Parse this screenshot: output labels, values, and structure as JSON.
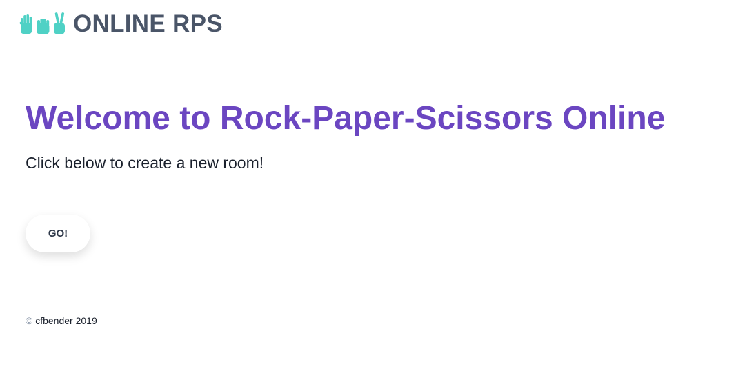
{
  "header": {
    "title": "ONLINE RPS",
    "icons": [
      "raised-hand-icon",
      "fist-icon",
      "victory-hand-icon"
    ],
    "icon_color": "#4fd1c5"
  },
  "main": {
    "heading": "Welcome to Rock-Paper-Scissors Online",
    "subtitle": "Click below to create a new room!",
    "go_label": "GO!"
  },
  "footer": {
    "copyright_symbol": "©",
    "text": "cfbender 2019"
  },
  "colors": {
    "heading": "#6b46c1",
    "title": "#4a5568",
    "accent": "#4fd1c5"
  }
}
